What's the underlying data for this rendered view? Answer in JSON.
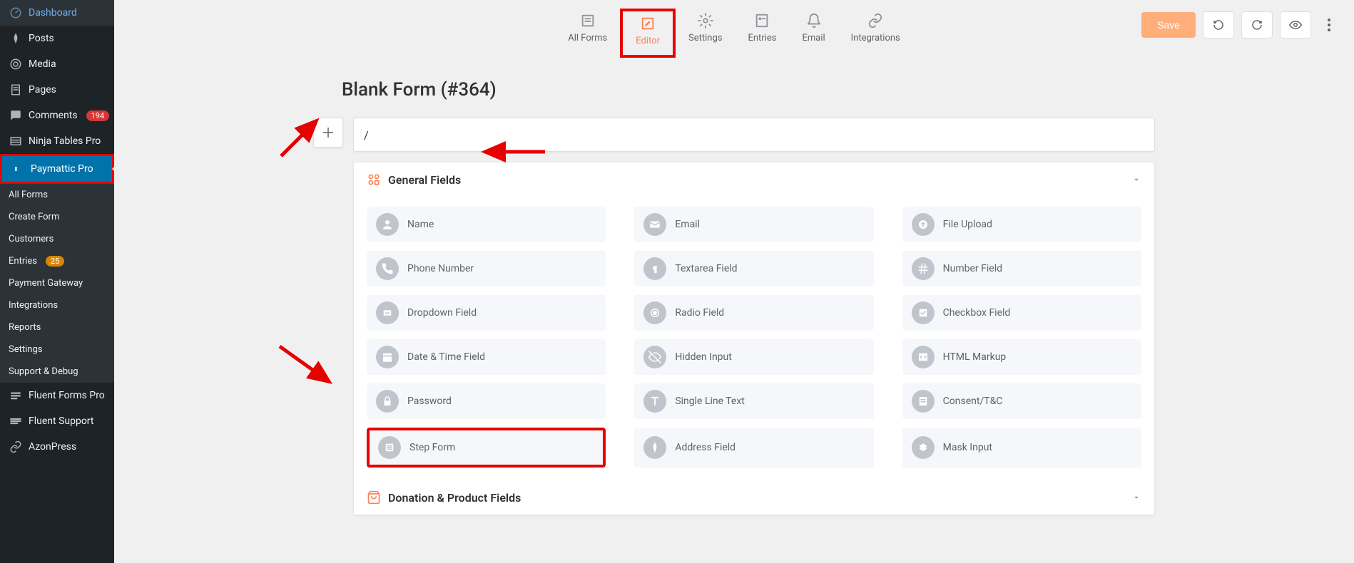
{
  "sidebar": {
    "items": [
      {
        "label": "Dashboard",
        "icon": "dashboard"
      },
      {
        "label": "Posts",
        "icon": "pin"
      },
      {
        "label": "Media",
        "icon": "media"
      },
      {
        "label": "Pages",
        "icon": "page"
      },
      {
        "label": "Comments",
        "icon": "comment",
        "badge": "194"
      },
      {
        "label": "Ninja Tables Pro",
        "icon": "table"
      },
      {
        "label": "Paymattic Pro",
        "icon": "paymattic",
        "active": true
      },
      {
        "label": "Fluent Forms Pro",
        "icon": "forms"
      },
      {
        "label": "Fluent Support",
        "icon": "support"
      },
      {
        "label": "AzonPress",
        "icon": "link"
      }
    ],
    "submenu": [
      {
        "label": "All Forms"
      },
      {
        "label": "Create Form"
      },
      {
        "label": "Customers"
      },
      {
        "label": "Entries",
        "badge": "25"
      },
      {
        "label": "Payment Gateway"
      },
      {
        "label": "Integrations"
      },
      {
        "label": "Reports"
      },
      {
        "label": "Settings"
      },
      {
        "label": "Support & Debug"
      }
    ]
  },
  "topTabs": [
    {
      "label": "All Forms",
      "icon": "list"
    },
    {
      "label": "Editor",
      "icon": "edit",
      "active": true
    },
    {
      "label": "Settings",
      "icon": "gear"
    },
    {
      "label": "Entries",
      "icon": "entries"
    },
    {
      "label": "Email",
      "icon": "bell"
    },
    {
      "label": "Integrations",
      "icon": "link"
    }
  ],
  "actions": {
    "save": "Save"
  },
  "page": {
    "title": "Blank Form (#364)",
    "inputValue": "/"
  },
  "sections": [
    {
      "title": "General Fields",
      "iconColor": "#ff7f50",
      "fields": [
        {
          "label": "Name",
          "icon": "user"
        },
        {
          "label": "Email",
          "icon": "mail"
        },
        {
          "label": "File Upload",
          "icon": "upload"
        },
        {
          "label": "Phone Number",
          "icon": "phone"
        },
        {
          "label": "Textarea Field",
          "icon": "textarea"
        },
        {
          "label": "Number Field",
          "icon": "hash"
        },
        {
          "label": "Dropdown Field",
          "icon": "dropdown"
        },
        {
          "label": "Radio Field",
          "icon": "radio"
        },
        {
          "label": "Checkbox Field",
          "icon": "checkbox"
        },
        {
          "label": "Date & Time Field",
          "icon": "calendar"
        },
        {
          "label": "Hidden Input",
          "icon": "hidden"
        },
        {
          "label": "HTML Markup",
          "icon": "html"
        },
        {
          "label": "Password",
          "icon": "lock"
        },
        {
          "label": "Single Line Text",
          "icon": "text"
        },
        {
          "label": "Consent/T&C",
          "icon": "consent"
        },
        {
          "label": "Step Form",
          "icon": "step",
          "highlight": true
        },
        {
          "label": "Address Field",
          "icon": "pin"
        },
        {
          "label": "Mask Input",
          "icon": "mask"
        }
      ]
    },
    {
      "title": "Donation & Product Fields",
      "iconColor": "#ff7f50"
    }
  ]
}
